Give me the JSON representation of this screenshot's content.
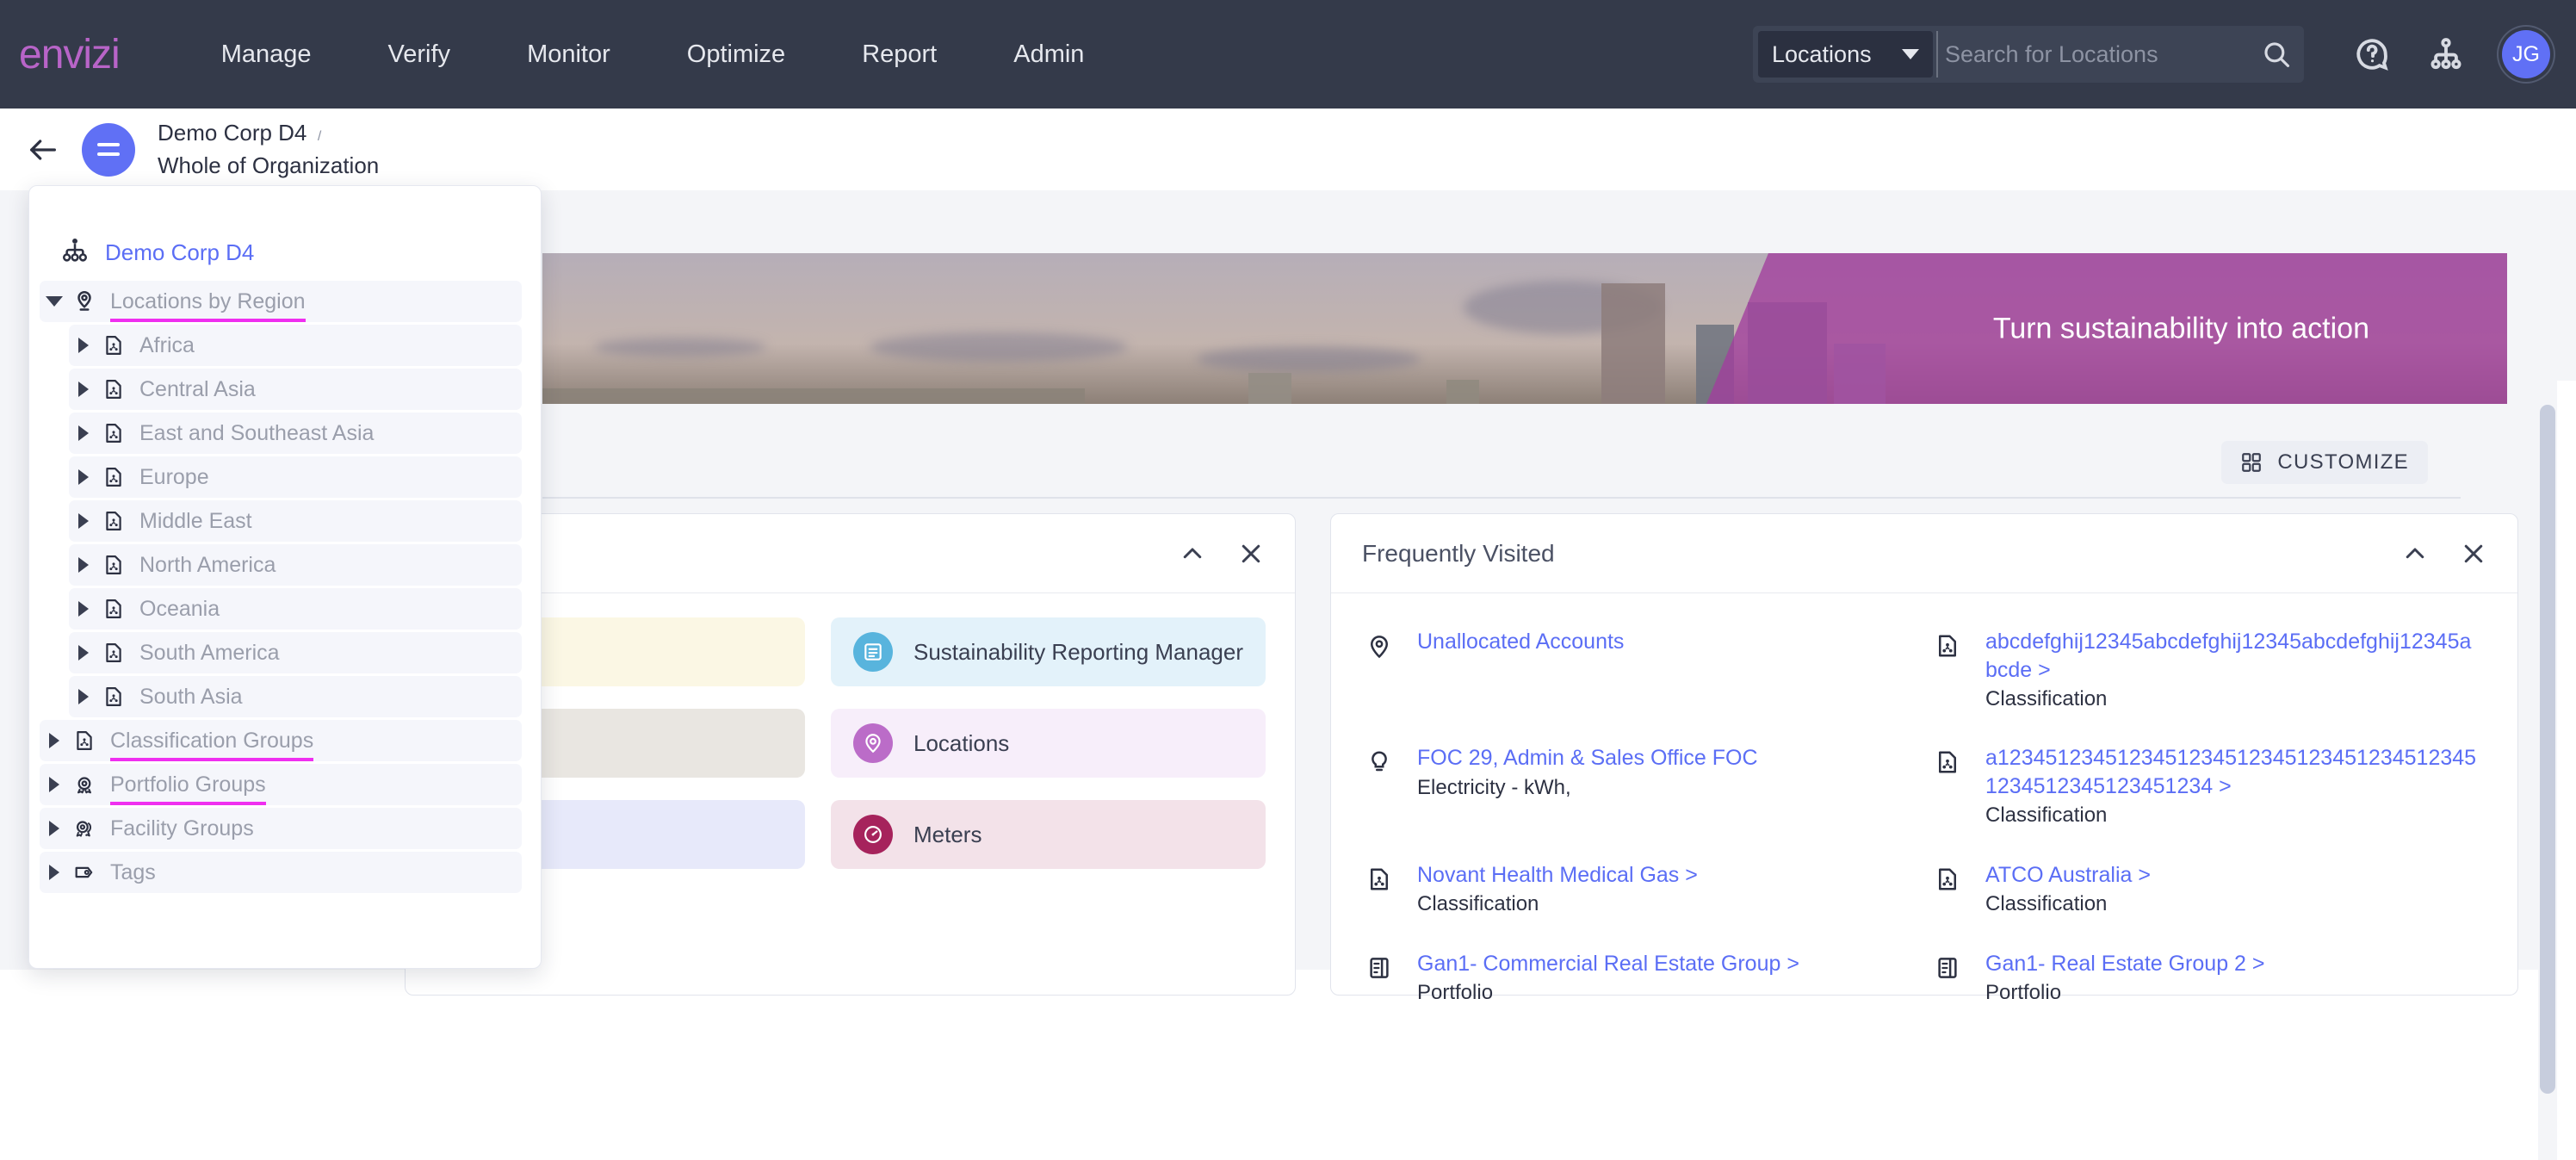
{
  "topnav": {
    "logo": "envizi",
    "links": [
      "Manage",
      "Verify",
      "Monitor",
      "Optimize",
      "Report",
      "Admin"
    ],
    "search": {
      "scope": "Locations",
      "placeholder": "Search for Locations",
      "value": "",
      "search_icon": "search-icon",
      "caret_icon": "chevron-down-icon"
    },
    "help_icon": "help-circle-icon",
    "hierarchy_icon": "org-hierarchy-icon",
    "avatar_initials": "JG",
    "bg_color": "#343a4a",
    "logo_color": "#b864c8",
    "avatar_color": "#6070f5"
  },
  "breadcrumb": {
    "back_icon": "back-arrow-icon",
    "menu_icon": "hamburger-icon",
    "org": "Demo Corp D4",
    "separator": "/",
    "scope": "Whole of Organization"
  },
  "banner": {
    "headline": "Turn sustainability into action",
    "overlay_color": "#a23d9e"
  },
  "customize": {
    "label": "CUSTOMIZE",
    "icon": "grid-squares-icon"
  },
  "tree_panel": {
    "root": {
      "label": "Demo Corp D4",
      "icon": "org-hierarchy-icon"
    },
    "nodes": [
      {
        "label": "Locations by Region",
        "icon": "location-pin-icon",
        "state": "expanded",
        "level": 1,
        "underline": true,
        "shade": true
      },
      {
        "label": "Africa",
        "icon": "classification-icon",
        "state": "collapsed",
        "level": 2,
        "underline": false,
        "shade": true
      },
      {
        "label": "Central Asia",
        "icon": "classification-icon",
        "state": "collapsed",
        "level": 2,
        "underline": false,
        "shade": true
      },
      {
        "label": "East and Southeast Asia",
        "icon": "classification-icon",
        "state": "collapsed",
        "level": 2,
        "underline": false,
        "shade": true
      },
      {
        "label": "Europe",
        "icon": "classification-icon",
        "state": "collapsed",
        "level": 2,
        "underline": false,
        "shade": true
      },
      {
        "label": "Middle East",
        "icon": "classification-icon",
        "state": "collapsed",
        "level": 2,
        "underline": false,
        "shade": true
      },
      {
        "label": "North America",
        "icon": "classification-icon",
        "state": "collapsed",
        "level": 2,
        "underline": false,
        "shade": true
      },
      {
        "label": "Oceania",
        "icon": "classification-icon",
        "state": "collapsed",
        "level": 2,
        "underline": false,
        "shade": true
      },
      {
        "label": "South America",
        "icon": "classification-icon",
        "state": "collapsed",
        "level": 2,
        "underline": false,
        "shade": true
      },
      {
        "label": "South Asia",
        "icon": "classification-icon",
        "state": "collapsed",
        "level": 2,
        "underline": false,
        "shade": true
      },
      {
        "label": "Classification Groups",
        "icon": "classification-icon",
        "state": "collapsed",
        "level": 1,
        "underline": true,
        "shade": true
      },
      {
        "label": "Portfolio Groups",
        "icon": "portfolio-icon",
        "state": "collapsed",
        "level": 1,
        "underline": true,
        "shade": true
      },
      {
        "label": "Facility Groups",
        "icon": "facility-icon",
        "state": "collapsed",
        "level": 1,
        "underline": false,
        "shade": true
      },
      {
        "label": "Tags",
        "icon": "tag-icon",
        "state": "collapsed",
        "level": 1,
        "underline": false,
        "shade": true
      }
    ],
    "underline_color": "#ef2ff0"
  },
  "tiles_card": {
    "title": "",
    "collapse_icon": "chevron-up-icon",
    "close_icon": "close-icon",
    "tiles": [
      {
        "label": "",
        "bg": "#fbf7e4",
        "icon_bg": "#e8d98a",
        "icon": "tile-icon"
      },
      {
        "label": "Sustainability Reporting Manager",
        "bg": "#e3f2fa",
        "icon_bg": "#58b4dd",
        "icon": "report-book-icon"
      },
      {
        "label": "",
        "bg": "#e9e6e1",
        "icon_bg": "#bdb3a6",
        "icon": "tile-icon"
      },
      {
        "label": "Locations",
        "bg": "#f7eefa",
        "icon_bg": "#bb6cc8",
        "icon": "location-pin-icon"
      },
      {
        "label": "",
        "bg": "#e7e9fa",
        "icon_bg": "#8d96e0",
        "icon": "tile-icon"
      },
      {
        "label": "Meters",
        "bg": "#f3e2e9",
        "icon_bg": "#a6235c",
        "icon": "meter-gauge-icon"
      }
    ]
  },
  "frequently_visited": {
    "title": "Frequently Visited",
    "collapse_icon": "chevron-up-icon",
    "close_icon": "close-icon",
    "items": [
      {
        "link": "Unallocated Accounts",
        "sub": "",
        "icon": "location-pin-icon"
      },
      {
        "link": "abcdefghij12345abcdefghij12345abcdefghij12345abcde >",
        "sub": "Classification",
        "icon": "classification-icon"
      },
      {
        "link": "FOC 29, Admin & Sales Office FOC",
        "sub": "Electricity - kWh,",
        "icon": "lightbulb-icon"
      },
      {
        "link": "a12345123451234512345123451234512345123451234512345123451234 >",
        "sub": "Classification",
        "icon": "classification-icon"
      },
      {
        "link": "Novant Health Medical Gas >",
        "sub": "Classification",
        "icon": "classification-icon"
      },
      {
        "link": "ATCO Australia >",
        "sub": "Classification",
        "icon": "classification-icon"
      },
      {
        "link": "Gan1- Commercial Real Estate Group >",
        "sub": "Portfolio",
        "icon": "portfolio-list-icon"
      },
      {
        "link": "Gan1- Real Estate Group 2 >",
        "sub": "Portfolio",
        "icon": "portfolio-list-icon"
      }
    ],
    "link_color": "#5b6ef5"
  },
  "scrollbar": {
    "name": "page-vertical-scrollbar"
  }
}
